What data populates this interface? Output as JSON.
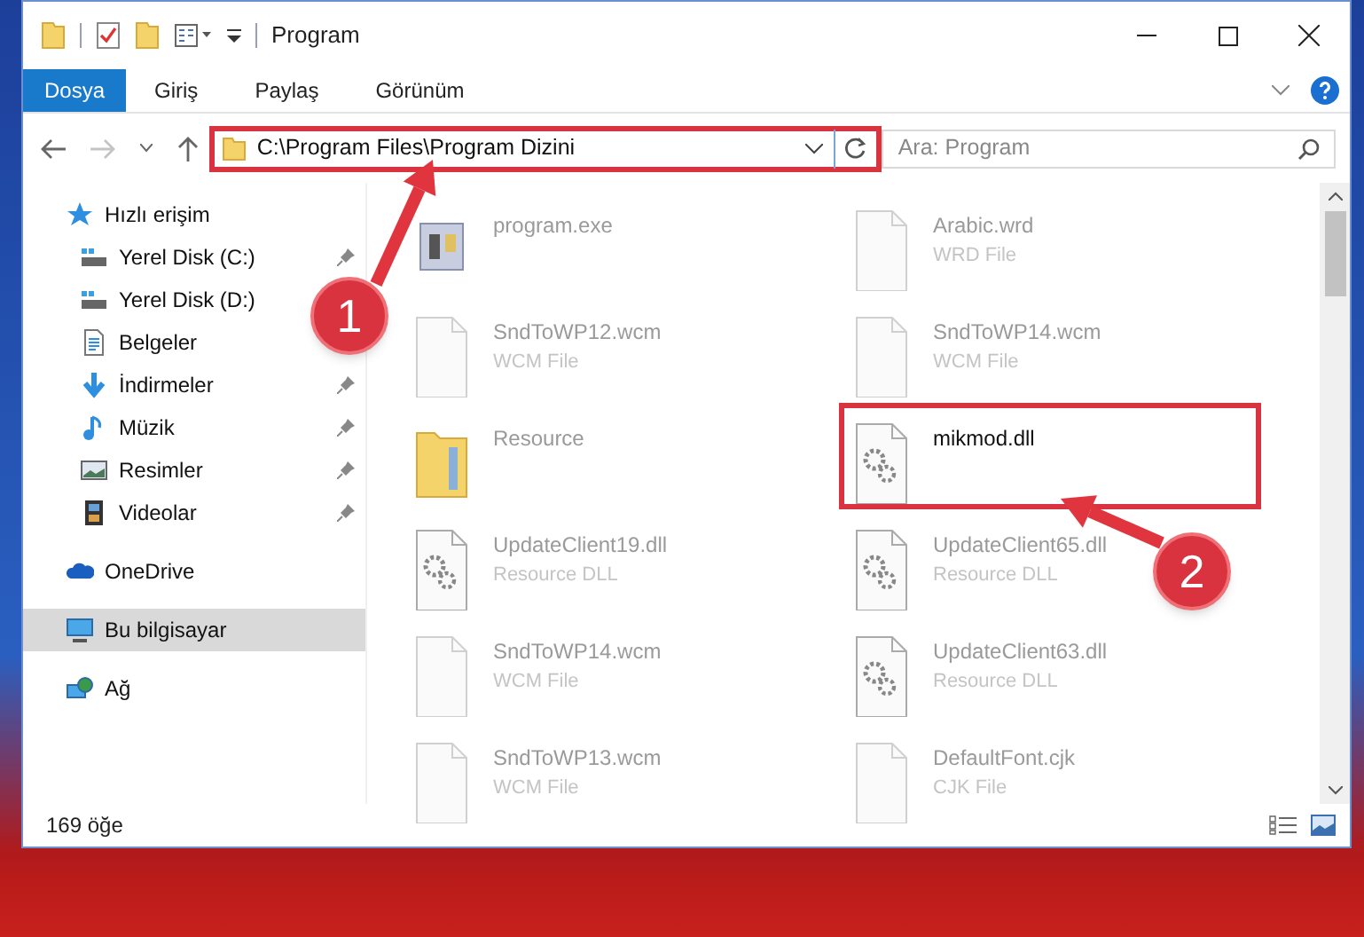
{
  "window": {
    "title": "Program"
  },
  "ribbon_tabs": [
    {
      "label": "Dosya",
      "selected": true
    },
    {
      "label": "Giriş",
      "selected": false
    },
    {
      "label": "Paylaş",
      "selected": false
    },
    {
      "label": "Görünüm",
      "selected": false
    }
  ],
  "address_bar": {
    "path": "C:\\Program Files\\Program Dizini",
    "highlighted": true
  },
  "search": {
    "placeholder": "Ara: Program"
  },
  "sidebar": {
    "items": [
      {
        "label": "Hızlı erişim",
        "kind": "star",
        "selected": false,
        "children": [
          {
            "label": "Yerel Disk (C:)",
            "kind": "drive",
            "selected": false,
            "pinned": true
          },
          {
            "label": "Yerel Disk (D:)",
            "kind": "drive",
            "selected": false,
            "pinned": false
          },
          {
            "label": "Belgeler",
            "kind": "document",
            "selected": false,
            "pinned": false
          },
          {
            "label": "İndirmeler",
            "kind": "download",
            "selected": false,
            "pinned": true
          },
          {
            "label": "Müzik",
            "kind": "music",
            "selected": false,
            "pinned": true
          },
          {
            "label": "Resimler",
            "kind": "pictures",
            "selected": false,
            "pinned": true
          },
          {
            "label": "Videolar",
            "kind": "video",
            "selected": false,
            "pinned": true
          }
        ]
      },
      {
        "label": "OneDrive",
        "kind": "cloud",
        "selected": false
      },
      {
        "label": "Bu bilgisayar",
        "kind": "computer",
        "selected": true
      },
      {
        "label": "Ağ",
        "kind": "network",
        "selected": false
      }
    ]
  },
  "files": [
    {
      "name": "program.exe",
      "kind": "exe",
      "blurred": true,
      "highlighted": false
    },
    {
      "name": "Arabic.wrd",
      "type": "WRD File",
      "kind": "file",
      "blurred": true,
      "highlighted": false
    },
    {
      "name": "SndToWP12.wcm",
      "type": "WCM File",
      "kind": "file",
      "blurred": true,
      "highlighted": false
    },
    {
      "name": "SndToWP14.wcm",
      "type": "WCM File",
      "kind": "file",
      "blurred": true,
      "highlighted": false
    },
    {
      "name": "Resource",
      "kind": "folder",
      "blurred": true,
      "highlighted": false
    },
    {
      "name": "mikmod.dll",
      "kind": "dll",
      "blurred": false,
      "highlighted": true
    },
    {
      "name": "UpdateClient19.dll",
      "type": "Resource DLL",
      "kind": "dll",
      "blurred": true,
      "highlighted": false
    },
    {
      "name": "UpdateClient65.dll",
      "type": "Resource DLL",
      "kind": "dll",
      "blurred": true,
      "highlighted": false
    },
    {
      "name": "SndToWP14.wcm",
      "type": "WCM File",
      "kind": "file",
      "blurred": true,
      "highlighted": false
    },
    {
      "name": "UpdateClient63.dll",
      "type": "Resource DLL",
      "kind": "dll",
      "blurred": true,
      "highlighted": false
    },
    {
      "name": "SndToWP13.wcm",
      "type": "WCM File",
      "kind": "file",
      "blurred": true,
      "highlighted": false
    },
    {
      "name": "DefaultFont.cjk",
      "type": "CJK File",
      "kind": "file",
      "blurred": true,
      "highlighted": false
    }
  ],
  "status_bar": {
    "item_count": "169 öğe"
  },
  "annotations": [
    {
      "label": "1"
    },
    {
      "label": "2"
    }
  ]
}
